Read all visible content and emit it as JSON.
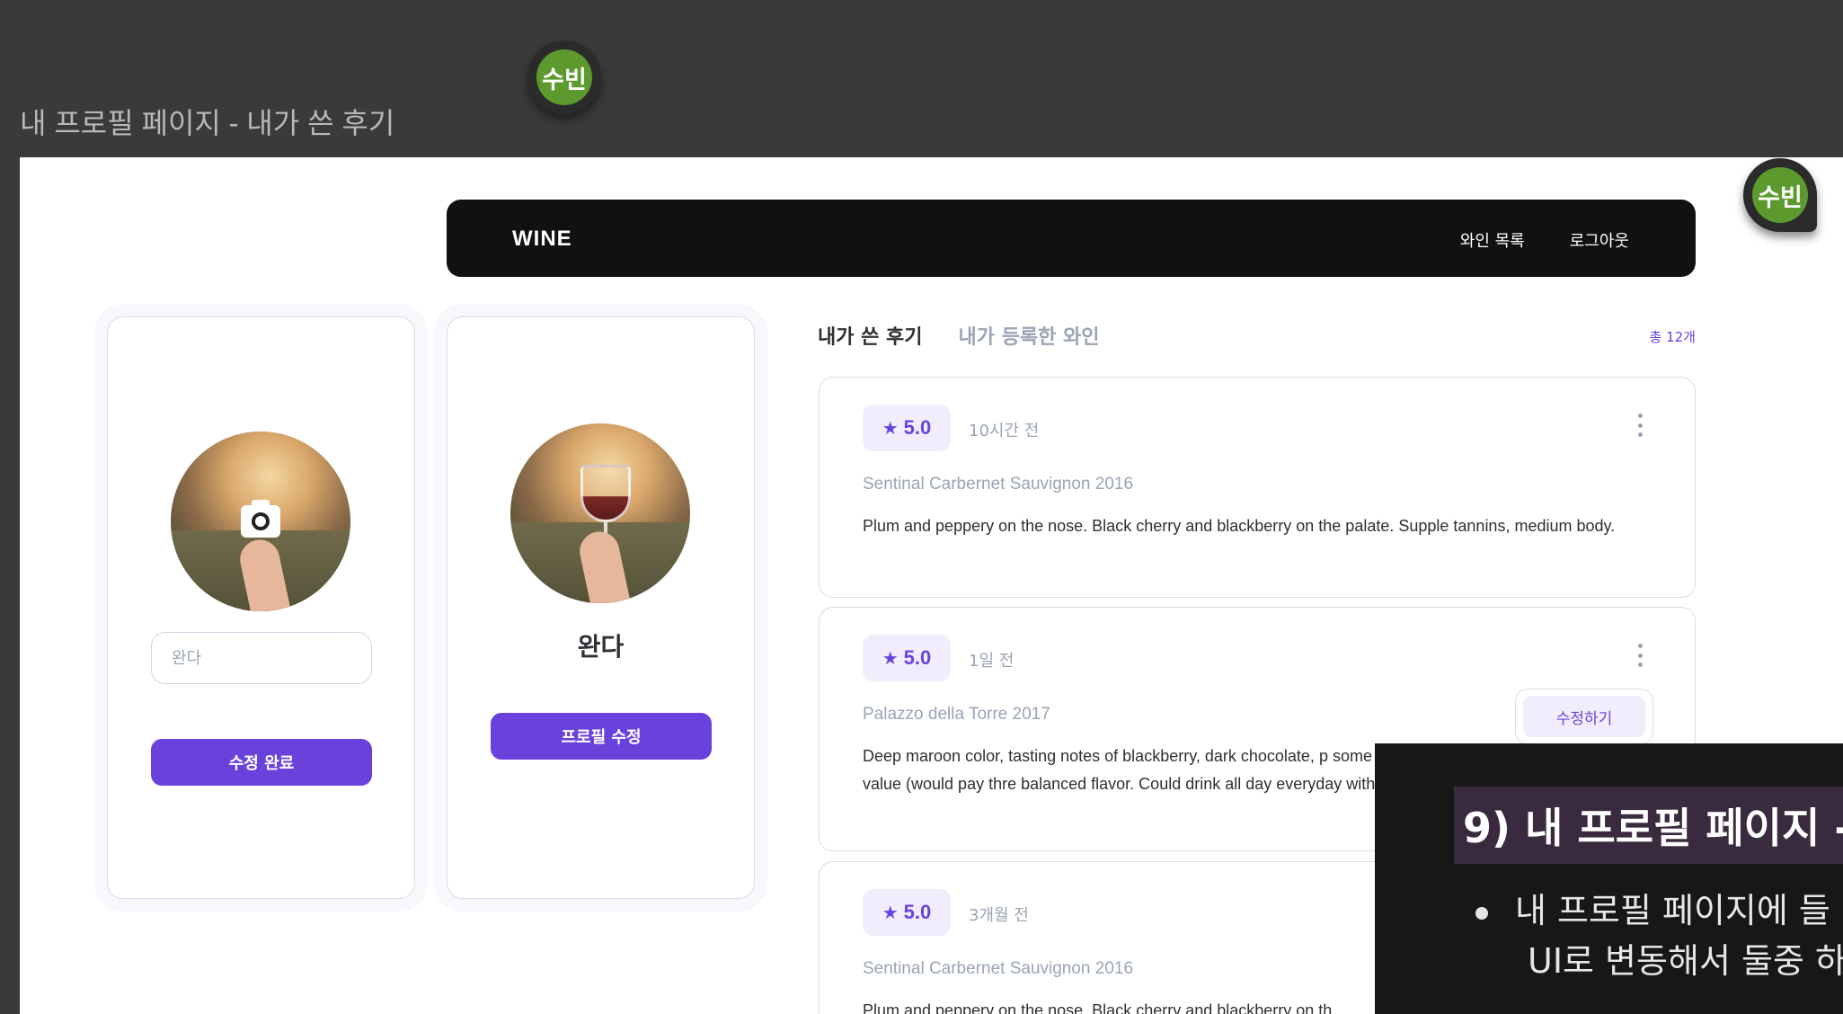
{
  "frame": {
    "title": "내 프로필 페이지 - 내가 쓴 후기",
    "badge_top": "수빈",
    "badge_right": "수빈"
  },
  "navbar": {
    "logo": "WINE",
    "links": [
      "와인 목록",
      "로그아웃"
    ]
  },
  "edit_card": {
    "name_placeholder": "완다",
    "camera_icon": "camera-icon",
    "submit_label": "수정 완료"
  },
  "view_card": {
    "name": "완다",
    "edit_label": "프로필 수정"
  },
  "tabs": {
    "active": "내가 쓴 후기",
    "inactive": "내가 등록한 와인"
  },
  "total_count": "총 12개",
  "reviews": [
    {
      "rating": "5.0",
      "time": "10시간 전",
      "wine": "Sentinal Carbernet Sauvignon 2016",
      "text": "Plum and peppery on the nose. Black cherry and blackberry on the palate. Supple tannins, medium body."
    },
    {
      "rating": "5.0",
      "time": "1일 전",
      "wine": "Palazzo della Torre 2017",
      "text": "Deep maroon color, tasting notes of blackberry, dark chocolate, p some smoky after notes. Big flavor. Amazing value (would pay thre balanced flavor. Could drink all day everyday with or without food.",
      "edit_label": "수정하기"
    },
    {
      "rating": "5.0",
      "time": "3개월 전",
      "wine": "Sentinal Carbernet Sauvignon 2016",
      "text": "Plum and peppery on the nose. Black cherry and blackberry on th"
    }
  ],
  "slide": {
    "heading": "9) 내 프로필 페이지 -",
    "bullet_line1": "내 프로필 페이지에 들",
    "bullet_line2": "UI로 변동해서 둘중 하"
  },
  "colors": {
    "accent": "#6a42db",
    "accent_light": "#f1edfc",
    "navbar": "#111114",
    "muted_text": "#9aa4b5",
    "badge_green": "#5c9a2e"
  }
}
